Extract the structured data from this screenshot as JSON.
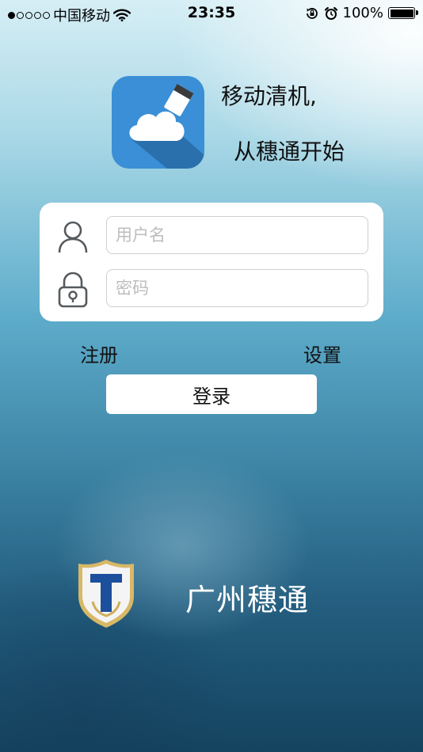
{
  "status_bar": {
    "signal_dots_filled": 1,
    "signal_dots_total": 5,
    "carrier": "中国移动",
    "wifi_icon": "wifi-icon",
    "time": "23:35",
    "orientation_lock_icon": "orientation-lock-icon",
    "alarm_icon": "alarm-clock-icon",
    "battery_percent": "100%",
    "battery_level": 1.0
  },
  "header": {
    "app_icon": "cloud-eraser-icon",
    "slogan_line1": "移动清机,",
    "slogan_line2": "从穗通开始"
  },
  "login_form": {
    "username_icon": "user-icon",
    "username_placeholder": "用户名",
    "username_value": "",
    "password_icon": "lock-icon",
    "password_placeholder": "密码",
    "password_value": ""
  },
  "links": {
    "register": "注册",
    "settings": "设置"
  },
  "login_button": "登录",
  "footer": {
    "logo_icon": "shield-t-logo-icon",
    "company_name": "广州穗通"
  }
}
